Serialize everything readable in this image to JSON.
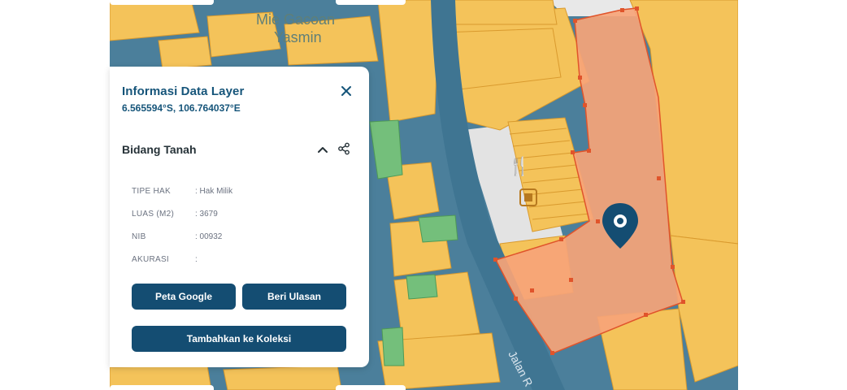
{
  "map": {
    "poi_label_line1": "Mie Gacoan",
    "poi_label_line2": "Yasmin",
    "road_label": "Jalan R"
  },
  "panel": {
    "title": "Informasi Data Layer",
    "coordinates": "6.565594°S, 106.764037°E",
    "section_title": "Bidang Tanah",
    "attributes": [
      {
        "key": "TIPE HAK",
        "value": ": Hak Milik"
      },
      {
        "key": "LUAS (M2)",
        "value": ": 3679"
      },
      {
        "key": "NIB",
        "value": ": 00932"
      },
      {
        "key": "AKURASI",
        "value": ":"
      }
    ],
    "buttons": {
      "google": "Peta Google",
      "review": "Beri Ulasan",
      "add_collection": "Tambahkan ke Koleksi"
    }
  },
  "colors": {
    "parcel": "#f4c35a",
    "parcel_border": "#d99a2e",
    "road": "#4b7f9b",
    "selected_parcel": "#f6a478",
    "selected_border": "#e0542b",
    "green": "#74bf7b",
    "accent": "#144d72"
  },
  "icons": [
    "close-icon",
    "chevron-up-icon",
    "share-icon",
    "map-pin-icon",
    "restaurant-icon",
    "coffee-icon"
  ]
}
